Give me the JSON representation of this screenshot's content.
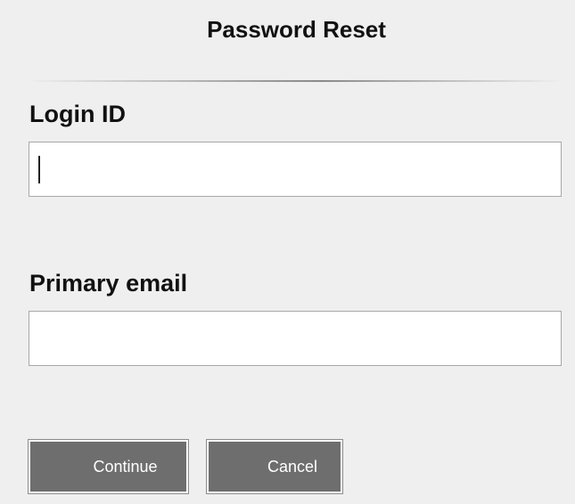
{
  "dialog": {
    "title": "Password Reset"
  },
  "form": {
    "login_id": {
      "label": "Login ID",
      "value": ""
    },
    "primary_email": {
      "label": "Primary email",
      "value": ""
    }
  },
  "actions": {
    "continue_label": "Continue",
    "cancel_label": "Cancel"
  },
  "colors": {
    "background": "#efefef",
    "button": "#6e6e6e",
    "button_text": "#ffffff"
  }
}
